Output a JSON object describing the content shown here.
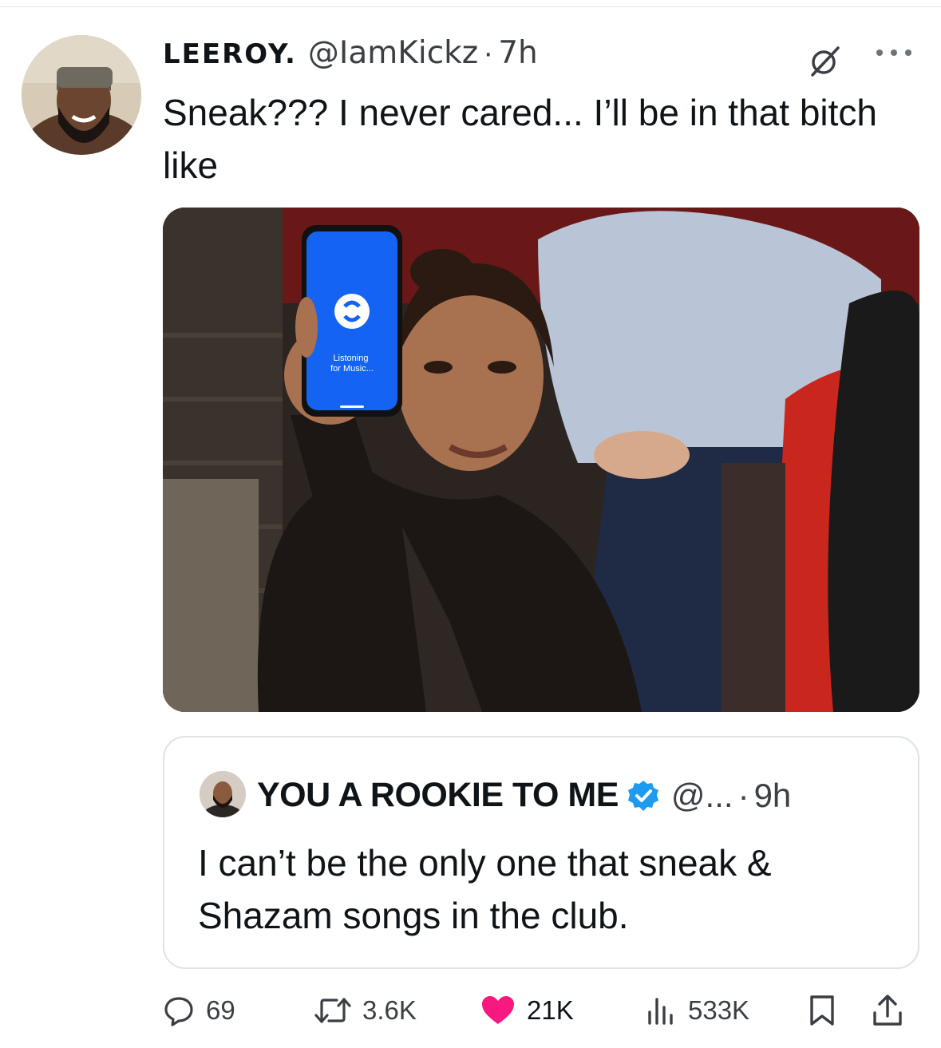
{
  "tweet": {
    "author_name": "LEEROY.",
    "author_handle": "@IamKickz",
    "separator": "·",
    "time": "7h",
    "text": "Sneak??? I never cared... I’ll be in that bitch like",
    "media": {
      "phone_screen_text": "Listoning for Music..."
    }
  },
  "quoted_tweet": {
    "author_name": "YOU A ROOKIE TO ME",
    "author_handle": "@...",
    "separator": "·",
    "time": "9h",
    "text": "I can’t be the only one that sneak & Shazam songs in the club.",
    "verified": true
  },
  "actions": {
    "replies": "69",
    "retweets": "3.6K",
    "likes": "21K",
    "views": "533K",
    "liked": true
  },
  "colors": {
    "like_pink": "#f91880",
    "verified_blue": "#1d9bf0",
    "text_primary": "#0f1419",
    "text_secondary": "#3b3f44",
    "border": "#dfe3e6",
    "shazam_blue": "#1463f3"
  },
  "icons": {
    "grok": "grok-icon",
    "more": "more-icon",
    "reply": "reply-icon",
    "retweet": "retweet-icon",
    "like": "heart-icon",
    "views": "views-icon",
    "bookmark": "bookmark-icon",
    "share": "share-icon",
    "verified": "verified-icon"
  }
}
